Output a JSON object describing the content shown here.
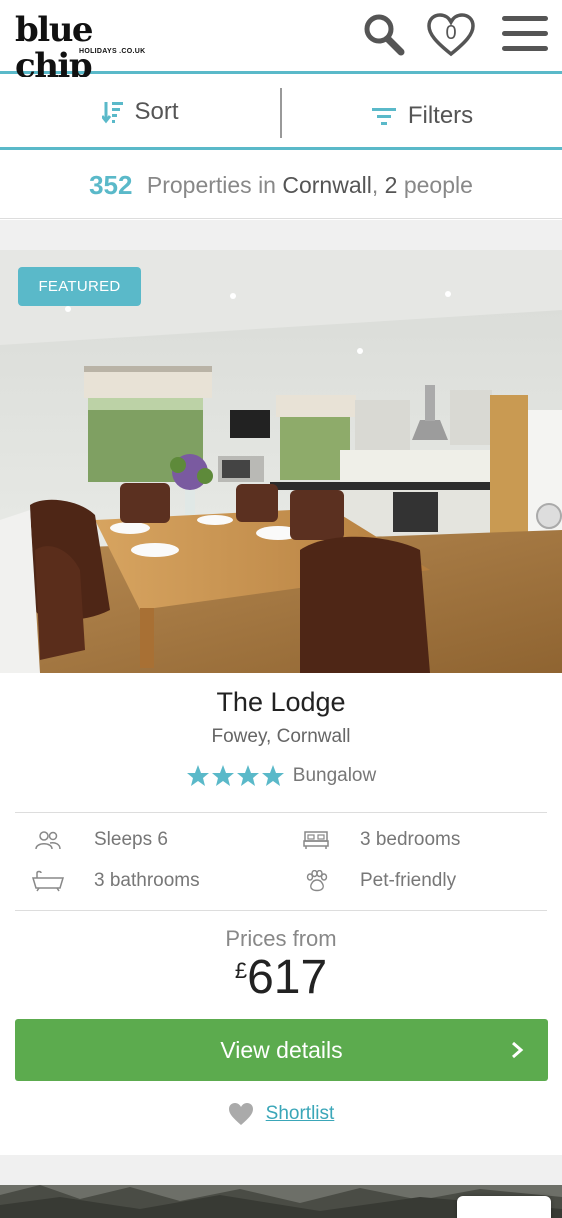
{
  "header": {
    "logo_main": "blue chip",
    "logo_sub": "HOLIDAYS .CO.UK",
    "shortlist_count": "0",
    "icons": [
      "search-icon",
      "heart-icon",
      "menu-icon"
    ]
  },
  "toolbar": {
    "sort_label": "Sort",
    "filters_label": "Filters"
  },
  "results": {
    "count": "352",
    "text_mid": " Properties in ",
    "location": "Cornwall",
    "text_comma": ", ",
    "people_count": "2",
    "people_text": " people"
  },
  "listing": {
    "badge": "FEATURED",
    "title": "The Lodge",
    "location": "Fowey, Cornwall",
    "stars": 4,
    "type": "Bungalow",
    "features": {
      "sleeps": "Sleeps 6",
      "bedrooms": "3 bedrooms",
      "bathrooms": "3 bathrooms",
      "pets": "Pet-friendly"
    },
    "prices_from_label": "Prices from",
    "currency": "£",
    "price": "617",
    "view_button": "View details",
    "shortlist_link": "Shortlist"
  },
  "colors": {
    "accent": "#5ab9c9",
    "button_green": "#5cab4e",
    "star": "#5ab9c9"
  }
}
